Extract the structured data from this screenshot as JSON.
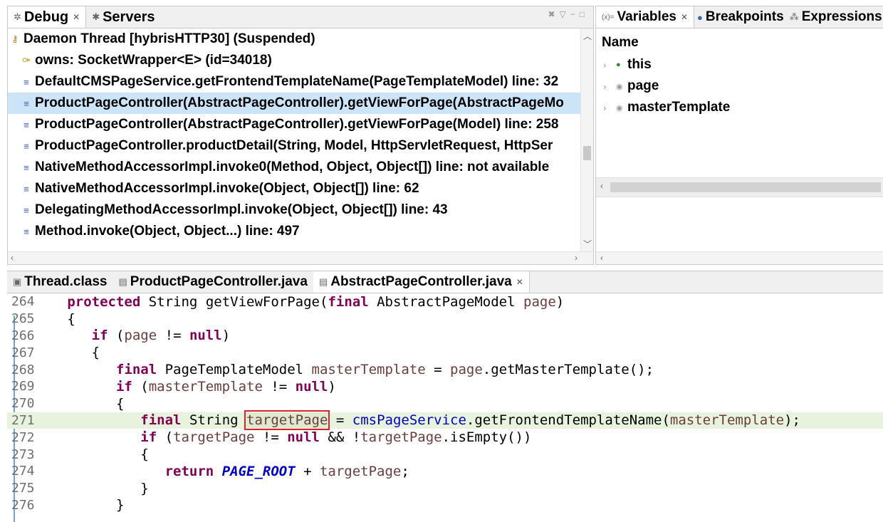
{
  "debug": {
    "tabs": [
      {
        "label": "Debug",
        "icon": "debug-icon",
        "closable": true
      },
      {
        "label": "Servers",
        "icon": "servers-icon",
        "closable": false
      }
    ],
    "frames": [
      "Daemon Thread [hybrisHTTP30] (Suspended)",
      "owns: SocketWrapper<E>  (id=34018)",
      "DefaultCMSPageService.getFrontendTemplateName(PageTemplateModel) line: 32",
      "ProductPageController(AbstractPageController).getViewForPage(AbstractPageMo",
      "ProductPageController(AbstractPageController).getViewForPage(Model) line: 258",
      "ProductPageController.productDetail(String, Model, HttpServletRequest, HttpSer",
      "NativeMethodAccessorImpl.invoke0(Method, Object, Object[]) line: not available",
      "NativeMethodAccessorImpl.invoke(Object, Object[]) line: 62",
      "DelegatingMethodAccessorImpl.invoke(Object, Object[]) line: 43",
      "Method.invoke(Object, Object...) line: 497"
    ],
    "selected_index": 3
  },
  "variables": {
    "tabs": [
      {
        "label": "Variables",
        "icon": "variables-icon",
        "closable": true
      },
      {
        "label": "Breakpoints",
        "icon": "breakpoints-icon",
        "closable": false
      },
      {
        "label": "Expressions",
        "icon": "expressions-icon",
        "closable": false
      }
    ],
    "column_header": "Name",
    "items": [
      "this",
      "page",
      "masterTemplate"
    ],
    "colors": {
      "this": "#2b8a2b",
      "page": "#888888",
      "masterTemplate": "#888888"
    }
  },
  "editor": {
    "tabs": [
      {
        "label": "Thread.class",
        "icon": "class-file-icon",
        "closable": false
      },
      {
        "label": "ProductPageController.java",
        "icon": "java-file-icon",
        "closable": false
      },
      {
        "label": "AbstractPageController.java",
        "icon": "java-file-icon",
        "closable": true
      }
    ],
    "line_numbers": [
      "264",
      "265",
      "266",
      "267",
      "268",
      "269",
      "270",
      "271",
      "272",
      "273",
      "274",
      "275",
      "276"
    ],
    "tokens": {
      "protected": "protected",
      "final": "final",
      "if": "if",
      "null": "null",
      "return": "return",
      "String": "String",
      "getViewForPage": "getViewForPage",
      "AbstractPageModel": "AbstractPageModel",
      "page": "page",
      "PageTemplateModel": "PageTemplateModel",
      "masterTemplate": "masterTemplate",
      "getMasterTemplate": "getMasterTemplate",
      "targetPage": "targetPage",
      "cmsPageService": "cmsPageService",
      "getFrontendTemplateName": "getFrontendTemplateName",
      "isEmpty": "isEmpty",
      "PAGE_ROOT": "PAGE_ROOT"
    },
    "current_line": "271",
    "highlight_color": "#d9232b"
  }
}
